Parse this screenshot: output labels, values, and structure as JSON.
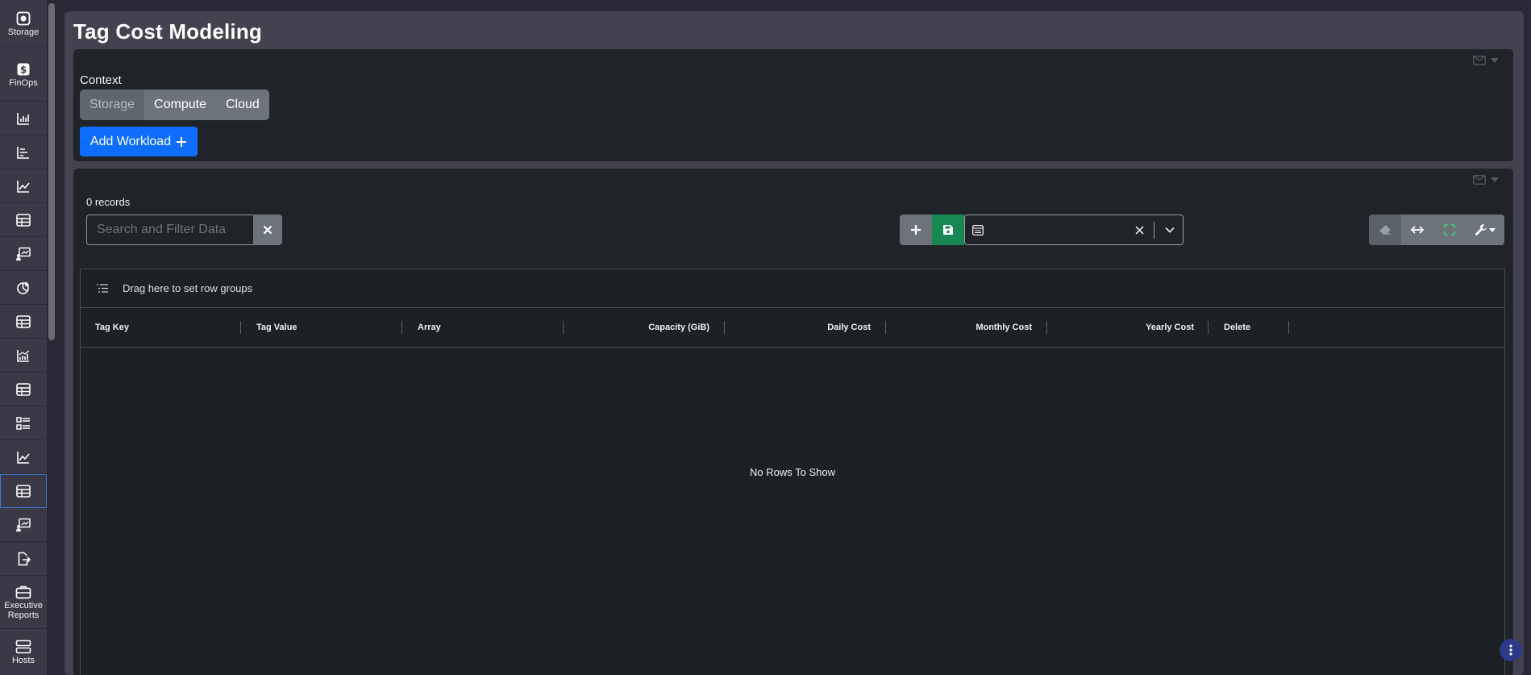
{
  "page": {
    "title": "Tag Cost Modeling"
  },
  "sidebar": {
    "items": [
      {
        "label": "Storage",
        "icon": "storage-icon"
      },
      {
        "label": "FinOps",
        "icon": "dollar-icon"
      },
      {
        "label": "",
        "icon": "bar-chart-icon"
      },
      {
        "label": "",
        "icon": "horizontal-bar-chart-icon"
      },
      {
        "label": "",
        "icon": "line-chart-icon"
      },
      {
        "label": "",
        "icon": "table-icon"
      },
      {
        "label": "",
        "icon": "presentation-icon"
      },
      {
        "label": "",
        "icon": "pie-chart-icon"
      },
      {
        "label": "",
        "icon": "table-icon"
      },
      {
        "label": "",
        "icon": "combo-chart-icon"
      },
      {
        "label": "",
        "icon": "table-icon"
      },
      {
        "label": "",
        "icon": "list-layout-icon"
      },
      {
        "label": "",
        "icon": "line-chart-icon"
      },
      {
        "label": "",
        "icon": "table-icon"
      },
      {
        "label": "",
        "icon": "presentation-icon"
      },
      {
        "label": "",
        "icon": "export-icon"
      },
      {
        "label": "Executive Reports",
        "icon": "briefcase-icon"
      },
      {
        "label": "Hosts",
        "icon": "server-icon"
      }
    ]
  },
  "context_panel": {
    "context_label": "Context",
    "tabs": [
      "Storage",
      "Compute",
      "Cloud"
    ],
    "active_tab": "Storage",
    "add_workload_label": "Add Workload"
  },
  "grid_panel": {
    "records_label": "0 records",
    "search_placeholder": "Search and Filter Data",
    "view_select_value": "",
    "group_bar_text": "Drag here to set row groups",
    "columns": [
      "Tag Key",
      "Tag Value",
      "Array",
      "Capacity (GiB)",
      "Daily Cost",
      "Monthly Cost",
      "Yearly Cost",
      "Delete"
    ],
    "empty_text": "No Rows To Show"
  },
  "colors": {
    "primary": "#0d6efd",
    "save_green": "#198754",
    "secondary": "#6c737b",
    "panel_bg": "#202328"
  }
}
